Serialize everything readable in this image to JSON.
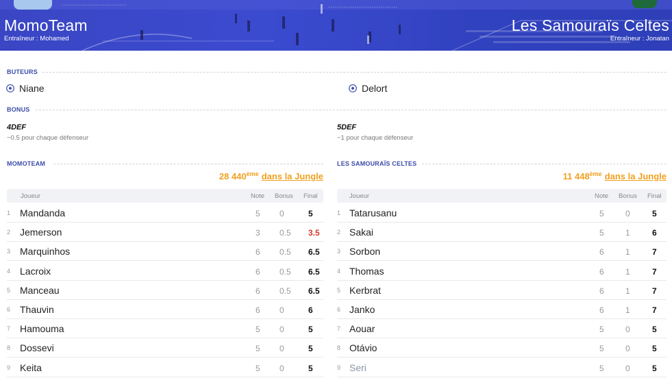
{
  "header": {
    "home": {
      "name": "MomoTeam",
      "coach": "Entraîneur : Mohamed"
    },
    "away": {
      "name": "Les Samouraïs Celtes",
      "coach": "Entraîneur : Jonatan"
    }
  },
  "scorers": {
    "label": "BUTEURS",
    "home": "Niane",
    "away": "Delort",
    "icon": "soccer-ball-icon"
  },
  "bonus": {
    "label": "BONUS",
    "home": {
      "code": "4DEF",
      "desc": "−0.5 pour chaque défenseur"
    },
    "away": {
      "code": "5DEF",
      "desc": "−1 pour chaque défenseur"
    }
  },
  "teams": {
    "home": {
      "label": "MOMOTEAM",
      "rank": "28 440",
      "rank_suffix": "ème",
      "rank_link": "dans la Jungle",
      "headers": {
        "player": "Joueur",
        "note": "Note",
        "bonus": "Bonus",
        "final": "Final"
      },
      "players": [
        {
          "num": "1",
          "name": "Mandanda",
          "note": "5",
          "bonus": "0",
          "final": "5"
        },
        {
          "num": "2",
          "name": "Jemerson",
          "note": "3",
          "bonus": "0.5",
          "final": "3.5"
        },
        {
          "num": "3",
          "name": "Marquinhos",
          "note": "6",
          "bonus": "0.5",
          "final": "6.5"
        },
        {
          "num": "4",
          "name": "Lacroix",
          "note": "6",
          "bonus": "0.5",
          "final": "6.5"
        },
        {
          "num": "5",
          "name": "Manceau",
          "note": "6",
          "bonus": "0.5",
          "final": "6.5"
        },
        {
          "num": "6",
          "name": "Thauvin",
          "note": "6",
          "bonus": "0",
          "final": "6"
        },
        {
          "num": "7",
          "name": "Hamouma",
          "note": "5",
          "bonus": "0",
          "final": "5"
        },
        {
          "num": "8",
          "name": "Dossevi",
          "note": "5",
          "bonus": "0",
          "final": "5"
        },
        {
          "num": "9",
          "name": "Keita",
          "note": "5",
          "bonus": "0",
          "final": "5"
        }
      ]
    },
    "away": {
      "label": "LES SAMOURAÏS CELTES",
      "rank": "11 448",
      "rank_suffix": "ème",
      "rank_link": "dans la Jungle",
      "headers": {
        "player": "Joueur",
        "note": "Note",
        "bonus": "Bonus",
        "final": "Final"
      },
      "players": [
        {
          "num": "1",
          "name": "Tatarusanu",
          "note": "5",
          "bonus": "0",
          "final": "5"
        },
        {
          "num": "2",
          "name": "Sakai",
          "note": "5",
          "bonus": "1",
          "final": "6"
        },
        {
          "num": "3",
          "name": "Sorbon",
          "note": "6",
          "bonus": "1",
          "final": "7"
        },
        {
          "num": "4",
          "name": "Thomas",
          "note": "6",
          "bonus": "1",
          "final": "7"
        },
        {
          "num": "5",
          "name": "Kerbrat",
          "note": "6",
          "bonus": "1",
          "final": "7"
        },
        {
          "num": "6",
          "name": "Janko",
          "note": "6",
          "bonus": "1",
          "final": "7"
        },
        {
          "num": "7",
          "name": "Aouar",
          "note": "5",
          "bonus": "0",
          "final": "5"
        },
        {
          "num": "8",
          "name": "Otávio",
          "note": "5",
          "bonus": "0",
          "final": "5"
        },
        {
          "num": "9",
          "name": "Seri",
          "note": "5",
          "bonus": "0",
          "final": "5"
        }
      ]
    }
  },
  "colors": {
    "banner": "#3a46c4",
    "accent": "#f0a020",
    "section": "#3b4ba8",
    "low_score": "#d23b2b"
  }
}
